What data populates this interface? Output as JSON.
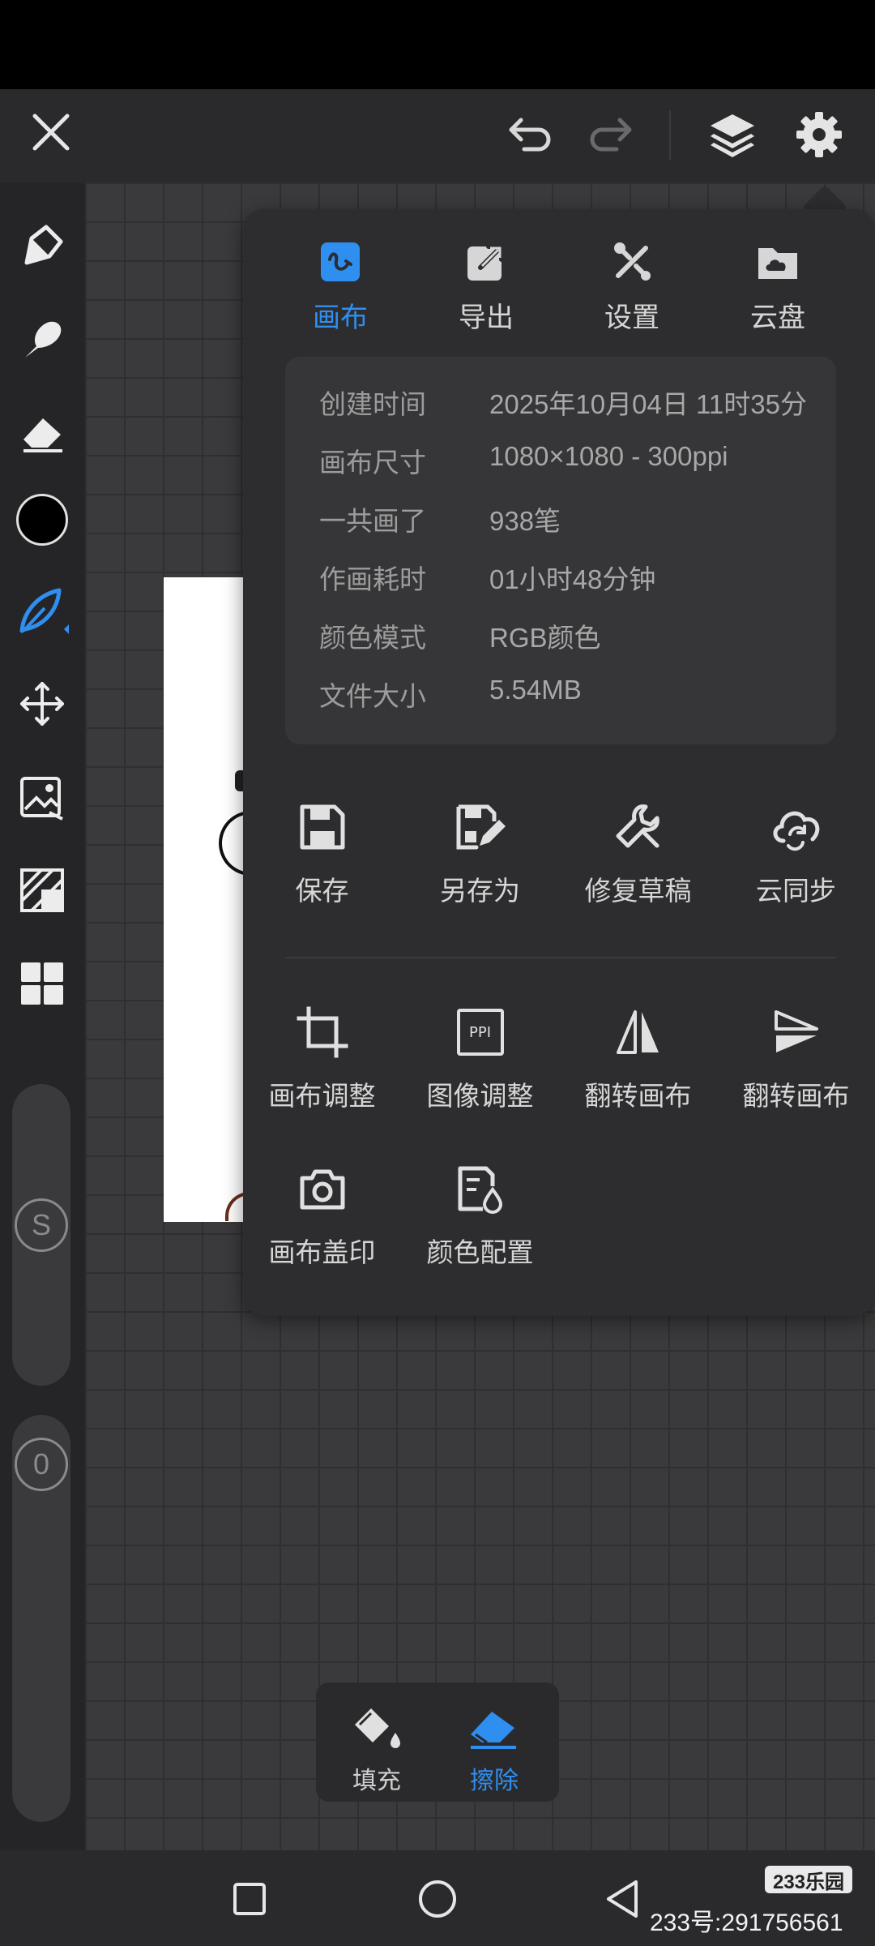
{
  "topbar": {
    "close_icon": "close-icon",
    "undo_icon": "undo-icon",
    "redo_icon": "redo-icon",
    "layers_icon": "layers-icon",
    "settings_icon": "gear-icon"
  },
  "leftbar": {
    "tools": [
      "pen-tool-icon",
      "smudge-icon",
      "eraser-icon",
      "color-swatch",
      "brush-icon",
      "move-icon",
      "image-import-icon",
      "texture-icon",
      "grid-icon"
    ],
    "active_color": "#000000",
    "accent": "#2f8ff0",
    "size_slider_label": "S",
    "opacity_slider_label": "0"
  },
  "panel": {
    "tabs": [
      {
        "label": "画布",
        "icon": "canvas-icon",
        "active": true
      },
      {
        "label": "导出",
        "icon": "export-icon",
        "active": false
      },
      {
        "label": "设置",
        "icon": "tools-icon",
        "active": false
      },
      {
        "label": "云盘",
        "icon": "cloud-folder-icon",
        "active": false
      }
    ],
    "info": [
      {
        "key": "创建时间",
        "value": "2025年10月04日 11时35分"
      },
      {
        "key": "画布尺寸",
        "value": "1080×1080 - 300ppi"
      },
      {
        "key": "一共画了",
        "value": "938笔"
      },
      {
        "key": "作画耗时",
        "value": "01小时48分钟"
      },
      {
        "key": "颜色模式",
        "value": "RGB颜色"
      },
      {
        "key": "文件大小",
        "value": "5.54MB"
      }
    ],
    "actions_row1": [
      {
        "label": "保存",
        "icon": "save-icon"
      },
      {
        "label": "另存为",
        "icon": "save-as-icon"
      },
      {
        "label": "修复草稿",
        "icon": "wrench-icon"
      },
      {
        "label": "云同步",
        "icon": "cloud-sync-icon"
      }
    ],
    "actions_row2": [
      {
        "label": "画布调整",
        "icon": "crop-icon"
      },
      {
        "label": "图像调整",
        "icon": "ppi-icon",
        "icon_text": "PPI"
      },
      {
        "label": "翻转画布",
        "icon": "flip-horizontal-icon"
      },
      {
        "label": "翻转画布",
        "icon": "flip-vertical-icon"
      }
    ],
    "actions_row3": [
      {
        "label": "画布盖印",
        "icon": "camera-icon"
      },
      {
        "label": "颜色配置",
        "icon": "color-profile-icon"
      }
    ]
  },
  "bottom_tools": [
    {
      "label": "填充",
      "icon": "fill-bucket-icon",
      "active": false
    },
    {
      "label": "擦除",
      "icon": "eraser-icon",
      "active": true
    }
  ],
  "navbar": {
    "recents_icon": "square-icon",
    "home_icon": "circle-icon",
    "back_icon": "triangle-back-icon"
  },
  "watermark": {
    "badge": "233乐园",
    "id_text": "233号:291756561"
  }
}
